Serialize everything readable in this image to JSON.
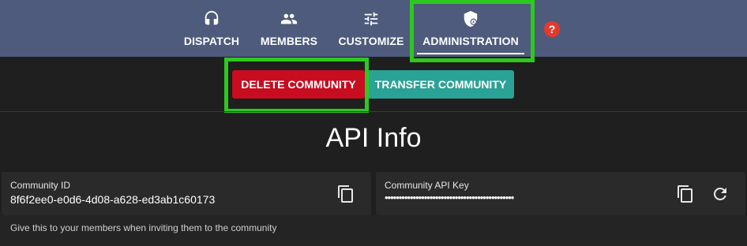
{
  "nav": {
    "items": [
      {
        "label": "DISPATCH",
        "icon": "headset-icon"
      },
      {
        "label": "MEMBERS",
        "icon": "people-icon"
      },
      {
        "label": "CUSTOMIZE",
        "icon": "sliders-icon"
      },
      {
        "label": "ADMINISTRATION",
        "icon": "shield-account-icon",
        "active": true
      }
    ],
    "help": "?"
  },
  "actions": {
    "delete_label": "DELETE COMMUNITY",
    "transfer_label": "TRANSFER COMMUNITY"
  },
  "section": {
    "title": "API Info"
  },
  "community_id": {
    "label": "Community ID",
    "value": "8f6f2ee0-e0d6-4d08-a628-ed3ab1c60173"
  },
  "api_key": {
    "label": "Community API Key",
    "value": "••••••••••••••••••••••••••••••••••••••••••••••"
  },
  "hint": "Give this to your members when inviting them to the community",
  "colors": {
    "nav_bg": "#4e5b7d",
    "delete": "#c70d1f",
    "transfer": "#2ba296",
    "highlight": "#2ec81e",
    "help": "#e8382b"
  }
}
